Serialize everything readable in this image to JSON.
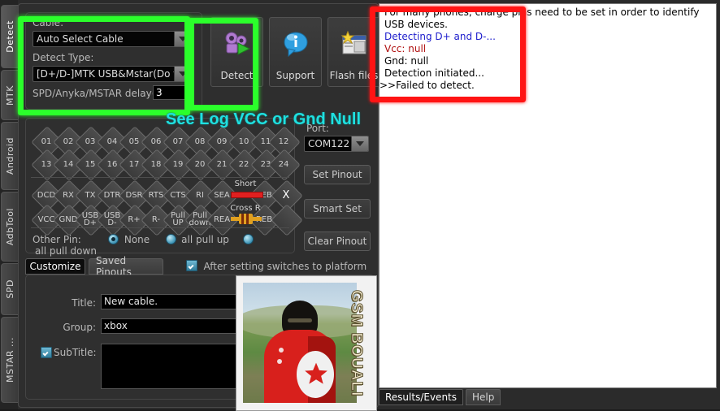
{
  "tabs_left": [
    {
      "label": "Detect",
      "selected": true
    },
    {
      "label": "MTK",
      "selected": false
    },
    {
      "label": "Android",
      "selected": false
    },
    {
      "label": "AdbTool",
      "selected": false
    },
    {
      "label": "SPD",
      "selected": false
    },
    {
      "label": "MSTAR ...",
      "selected": false
    }
  ],
  "detect_group": {
    "cable_label": "Cable:",
    "cable_value": "Auto Select Cable",
    "detect_type_label": "Detect Type:",
    "detect_type_value": "[D+/D-]MTK USB&Mstar(Do find BC",
    "delay_label": "SPD/Anyka/MSTAR delay(s):",
    "delay_value": "3"
  },
  "action_buttons": [
    {
      "label": "Detect",
      "icon": "gears-play-icon"
    },
    {
      "label": "Support",
      "icon": "info-bubble-icon"
    },
    {
      "label": "Flash files",
      "icon": "flash-files-icon"
    }
  ],
  "pin_numbers_row1": [
    "01",
    "02",
    "03",
    "04",
    "05",
    "06",
    "07",
    "08",
    "09",
    "10",
    "11",
    "12"
  ],
  "pin_numbers_row2": [
    "13",
    "14",
    "15",
    "16",
    "17",
    "18",
    "19",
    "20",
    "21",
    "22",
    "23",
    "24"
  ],
  "pin_signals_row1": [
    "DCD",
    "RX",
    "TX",
    "DTR",
    "DSR",
    "RTS",
    "CTS",
    "RI",
    "SEA",
    "SEB",
    "X"
  ],
  "pin_signals_row2": [
    "VCC",
    "GND",
    "USB D+",
    "USB D-",
    "R+",
    "R-",
    "Pull UP",
    "Pull down",
    "REA",
    "REB",
    ""
  ],
  "pin_connector_labels": {
    "short": "Short",
    "cross": "Cross R"
  },
  "other_pin": {
    "label": "Other Pin:",
    "options": [
      {
        "label": "None",
        "selected": true
      },
      {
        "label": "all pull up",
        "selected": false
      },
      {
        "label": "all pull down",
        "selected": false
      }
    ]
  },
  "port_section": {
    "port_label": "Port:",
    "port_value": "COM122",
    "set_pinout": "Set Pinout",
    "smart_set": "Smart Set",
    "clear_pinout": "Clear Pinout"
  },
  "pinout_tabs": [
    {
      "label": "Customize",
      "selected": true
    },
    {
      "label": "Saved Pinouts",
      "selected": false
    }
  ],
  "after_setting": {
    "label": "After setting switches to platform",
    "checked": true
  },
  "form": {
    "title_label": "Title:",
    "title_value": "New cable.",
    "group_label": "Group:",
    "group_value": "xbox",
    "subtitle_label": "SubTitle:",
    "subtitle_checked": true,
    "subtitle_value": ""
  },
  "photo": {
    "watermark": "GSM BOUALI"
  },
  "log": {
    "lines": [
      {
        "text": "For many phones, charge pins need to be set in order to identify USB devices.",
        "style": "bold"
      },
      {
        "text": "Detecting D+ and D-...",
        "style": "blue"
      },
      {
        "text": "Vcc: null",
        "style": "red"
      },
      {
        "text": "Gnd: null",
        "style": "bold"
      },
      {
        "text": "Detection initiated...",
        "style": "bold"
      },
      {
        "text": ">>Failed to detect.",
        "style": "bold"
      }
    ]
  },
  "bottom_tabs": [
    {
      "label": "Results/Events",
      "selected": true
    },
    {
      "label": "Help",
      "selected": false
    }
  ],
  "annotations": {
    "cyan_text": "See Log VCC or Gnd Null",
    "green_color": "#2bff2b",
    "red_color": "#ff1414",
    "cyan_color": "#1fe0e0"
  }
}
